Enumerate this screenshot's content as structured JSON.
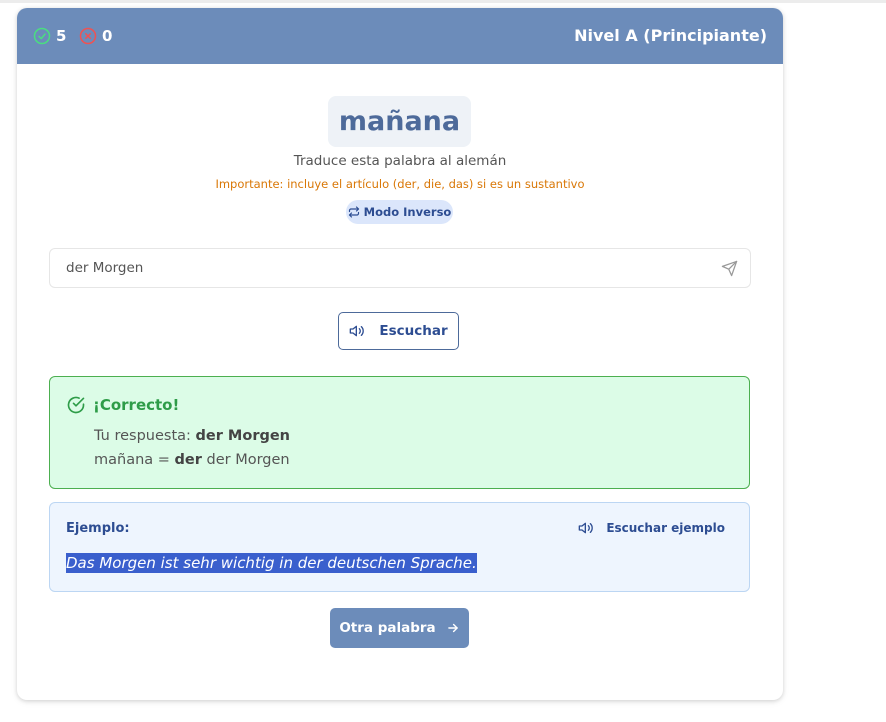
{
  "header": {
    "correct_count": "5",
    "wrong_count": "0",
    "level": "Nivel A (Principiante)"
  },
  "prompt": {
    "word": "mañana",
    "instruction": "Traduce esta palabra al alemán",
    "important_note": "Importante: incluye el artículo (der, die, das) si es un sustantivo",
    "mode_label": "Modo Inverso"
  },
  "answer": {
    "value": "der Morgen",
    "placeholder": ""
  },
  "listen_label": "Escuchar",
  "result": {
    "title": "¡Correcto!",
    "your_answer_label": "Tu respuesta:",
    "your_answer_value": "der Morgen",
    "translation_prefix": "mañana =",
    "translation_article": "der",
    "translation_rest": "der Morgen"
  },
  "example": {
    "label": "Ejemplo:",
    "listen_label": "Escuchar ejemplo",
    "sentence": "Das Morgen ist sehr wichtig in der deutschen Sprache."
  },
  "next_label": "Otra palabra",
  "colors": {
    "header_bg": "#6c8cba",
    "success_green": "#2e9c48",
    "error_red": "#e05555",
    "warning_orange": "#d97706",
    "accent_blue": "#2d4d92"
  },
  "icons": {
    "correct": "check-circle-icon",
    "wrong": "x-circle-icon",
    "mode": "swap-arrows-icon",
    "send": "send-icon",
    "speaker": "speaker-icon",
    "next": "arrow-right-icon"
  }
}
